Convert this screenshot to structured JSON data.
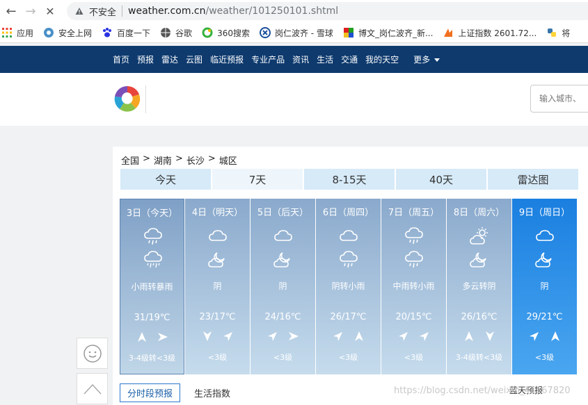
{
  "browser": {
    "insecure_label": "不安全",
    "url_host": "weather.com.cn",
    "url_path": "/weather/101250101.shtml",
    "bookmarks": [
      {
        "label": "应用",
        "icon": "apps-grid-icon"
      },
      {
        "label": "安全上网",
        "icon": "mobile-icon"
      },
      {
        "label": "百度一下",
        "icon": "baidu-paw-icon"
      },
      {
        "label": "谷歌",
        "icon": "globe-icon"
      },
      {
        "label": "360搜索",
        "icon": "360-icon"
      },
      {
        "label": "岗仁波齐 - 雪球",
        "icon": "xueqiu-icon"
      },
      {
        "label": "博文_岗仁波齐_新...",
        "icon": "blog-icon"
      },
      {
        "label": "上证指数 2601.72...",
        "icon": "stock-icon"
      },
      {
        "label": "将",
        "icon": "python-icon"
      }
    ]
  },
  "site_nav": {
    "items": [
      "首页",
      "预报",
      "雷达",
      "云图",
      "临近预报",
      "专业产品",
      "资讯",
      "生活",
      "交通",
      "我的天空"
    ],
    "more": "更多"
  },
  "search": {
    "placeholder": "输入城市、"
  },
  "breadcrumb": [
    "全国",
    ">",
    "湖南",
    ">",
    "长沙",
    ">",
    "城区"
  ],
  "tabs": [
    "今天",
    "7天",
    "8-15天",
    "40天",
    "雷达图"
  ],
  "days": [
    {
      "date": "3日（今天）",
      "desc": "小雨转暴雨",
      "temp": "31/19℃",
      "level": "3-4级转<3级",
      "icon1": "rain-icon",
      "icon2": "heavy-rain-icon"
    },
    {
      "date": "4日（明天）",
      "desc": "阴",
      "temp": "23/17℃",
      "level": "<3级",
      "icon1": "cloud-icon",
      "icon2": "overcast-moon-icon"
    },
    {
      "date": "5日（后天）",
      "desc": "阴",
      "temp": "24/16℃",
      "level": "<3级",
      "icon1": "cloud-icon",
      "icon2": "overcast-moon-icon"
    },
    {
      "date": "6日（周四）",
      "desc": "阴转小雨",
      "temp": "26/17℃",
      "level": "<3级",
      "icon1": "cloud-icon",
      "icon2": "rain-icon"
    },
    {
      "date": "7日（周五）",
      "desc": "中雨转小雨",
      "temp": "20/15℃",
      "level": "<3级",
      "icon1": "rain-icon",
      "icon2": "rain-icon"
    },
    {
      "date": "8日（周六）",
      "desc": "多云转阴",
      "temp": "26/16℃",
      "level": "3-4级转<3级",
      "icon1": "sun-cloud-icon",
      "icon2": "overcast-moon-icon"
    },
    {
      "date": "9日（周日）",
      "desc": "阴",
      "temp": "29/21℃",
      "level": "<3级",
      "icon1": "cloud-icon",
      "icon2": "overcast-moon-icon"
    }
  ],
  "bottom_tabs": [
    "分时段预报",
    "生活指数"
  ],
  "blue_sky": "蓝天预报",
  "watermark": "https://blog.csdn.net/weixin_41167820"
}
